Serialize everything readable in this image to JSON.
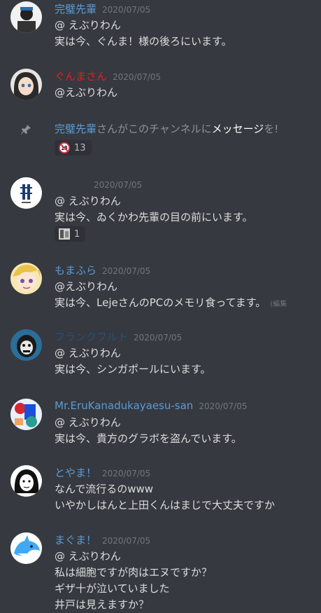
{
  "messages": [
    {
      "name": "完璧先輩",
      "color": "#5b9bd5",
      "time": "2020/07/05",
      "lines": [
        "@ えぶりわん",
        "実は今、ぐんま！様の後ろにいます。"
      ]
    },
    {
      "name": "ぐんまさん",
      "color": "#e02020",
      "time": "2020/07/05",
      "lines": [
        "@えぶりわん"
      ]
    },
    {
      "system": {
        "name": "完璧先輩",
        "mid": "さんがこのチャンネルに",
        "link": "メッセージ",
        "tail": "を!"
      },
      "reaction": {
        "emoji": "18",
        "count": "13"
      }
    },
    {
      "name": "",
      "color": "#5b9bd5",
      "time": "2020/07/05",
      "lines": [
        "@ えぶりわん",
        "実は今、ゐくかわ先輩の目の前にいます。"
      ],
      "reaction": {
        "emoji": "img",
        "count": "1"
      }
    },
    {
      "name": "もまふら",
      "color": "#5b9bd5",
      "time": "2020/07/05",
      "lines": [
        "@えぶりわん",
        "実は今、LejeさんのPCのメモリ食ってます。"
      ],
      "edited": "(編集"
    },
    {
      "name": "フランクフルト",
      "color": "#23527c",
      "time": "2020/07/05",
      "lines": [
        "@ えぶりわん",
        "実は今、シンガポールにいます。"
      ]
    },
    {
      "name": "Mr.EruKanadukayaesu-san",
      "color": "#5b9bd5",
      "time": "2020/07/05",
      "lines": [
        "@ えぶりわん",
        "実は今、貴方のグラボを盗んでいます。"
      ]
    },
    {
      "name": "とやま！",
      "color": "#5b9bd5",
      "time": "2020/07/05",
      "lines": [
        "なんで流行るのwww",
        "いやかしはんと上田くんはまじで大丈夫ですか"
      ]
    },
    {
      "name": "まぐま！",
      "color": "#5b9bd5",
      "time": "2020/07/05",
      "lines": [
        "@ えぶりわん",
        "私は細胞ですが肉はエヌですか？",
        "ギザ十が泣いていました",
        "井戸は見えますか？"
      ]
    }
  ]
}
